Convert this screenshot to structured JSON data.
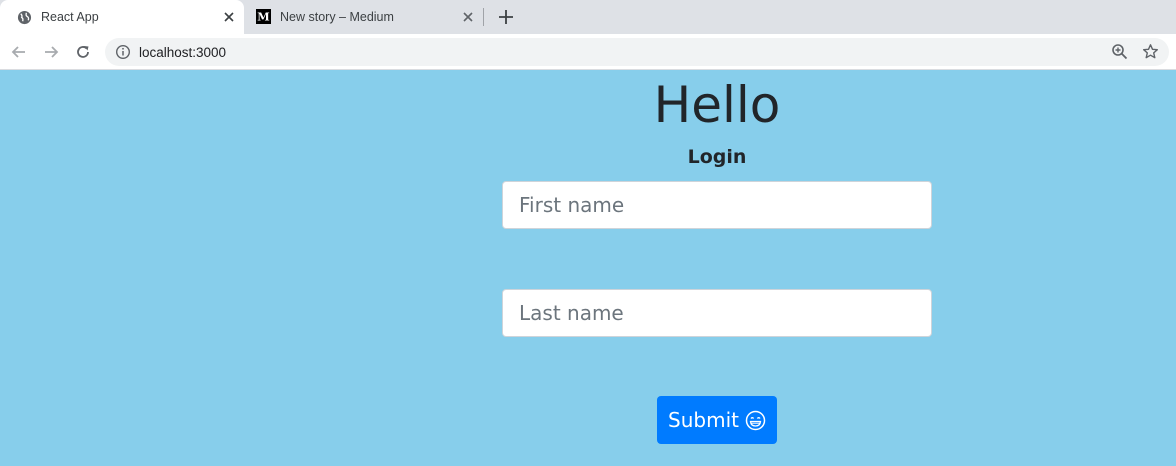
{
  "browser": {
    "tabs": [
      {
        "title": "React App",
        "active": true
      },
      {
        "title": "New story – Medium",
        "active": false
      }
    ],
    "url": "localhost:3000"
  },
  "page": {
    "heading": "Hello",
    "subheading": "Login",
    "first_name_placeholder": "First name",
    "last_name_placeholder": "Last name",
    "submit_label": "Submit"
  },
  "colors": {
    "background": "#87ceeb",
    "button": "#007bff"
  }
}
